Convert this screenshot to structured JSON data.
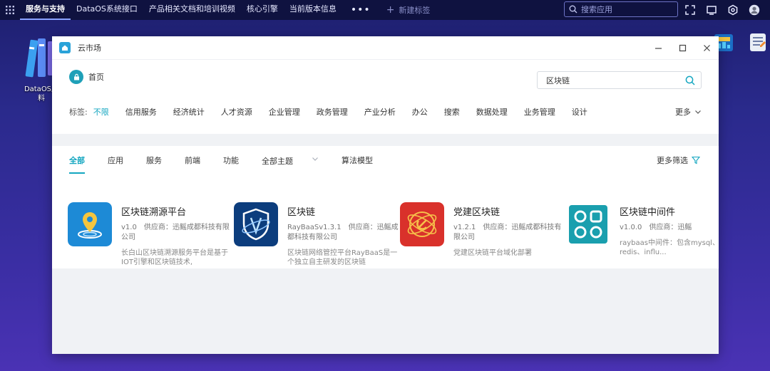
{
  "taskbar": {
    "tabs": [
      {
        "label": "服务与支持",
        "active": true
      },
      {
        "label": "DataOS系统接口"
      },
      {
        "label": "产品相关文档和培训视频"
      },
      {
        "label": "核心引擎"
      },
      {
        "label": "当前版本信息"
      }
    ],
    "more": "•••",
    "new_tab": "新建标签",
    "search_placeholder": "搜索应用"
  },
  "desktop": {
    "icon_label": "DataOS产\n料"
  },
  "window": {
    "title": "云市场",
    "home_label": "首页",
    "search_value": "区块链",
    "tags_label": "标签:",
    "tags": [
      "不限",
      "信用服务",
      "经济统计",
      "人才资源",
      "企业管理",
      "政务管理",
      "产业分析",
      "办公",
      "搜索",
      "数据处理",
      "业务管理",
      "设计"
    ],
    "more_tags": "更多",
    "filters": [
      "全部",
      "应用",
      "服务",
      "前端",
      "功能"
    ],
    "topic": "全部主题",
    "algo": "算法模型",
    "more_filter": "更多筛选",
    "cards": [
      {
        "name": "区块链溯源平台",
        "version": "v1.0",
        "supplier": "供应商：迅鳐成都科技有限公司",
        "desc": "长白山区块链溯源服务平台是基于IOT引擎和区块链技术,",
        "color": "#1d8ad6",
        "icon": "location-pin-icon"
      },
      {
        "name": "区块链",
        "version": "RayBaaSv1.3.1",
        "supplier": "供应商：迅鳐成都科技有限公司",
        "desc": "区块链网络管控平台RayBaaS是一个独立自主研发的区块链",
        "color": "#0c3d7d",
        "icon": "shield-chain-icon"
      },
      {
        "name": "党建区块链",
        "version": "v1.2.1",
        "supplier": "供应商：迅鳐成都科技有限公司",
        "desc": "党建区块链平台域化部署",
        "color": "#d9312b",
        "icon": "party-emblem-icon"
      },
      {
        "name": "区块链中间件",
        "version": "v1.0.0",
        "supplier": "供应商：迅鳐",
        "desc": "raybaas中间件：包含mysql、redis、influ...",
        "color": "#1a9fae",
        "icon": "middleware-icon"
      }
    ]
  }
}
